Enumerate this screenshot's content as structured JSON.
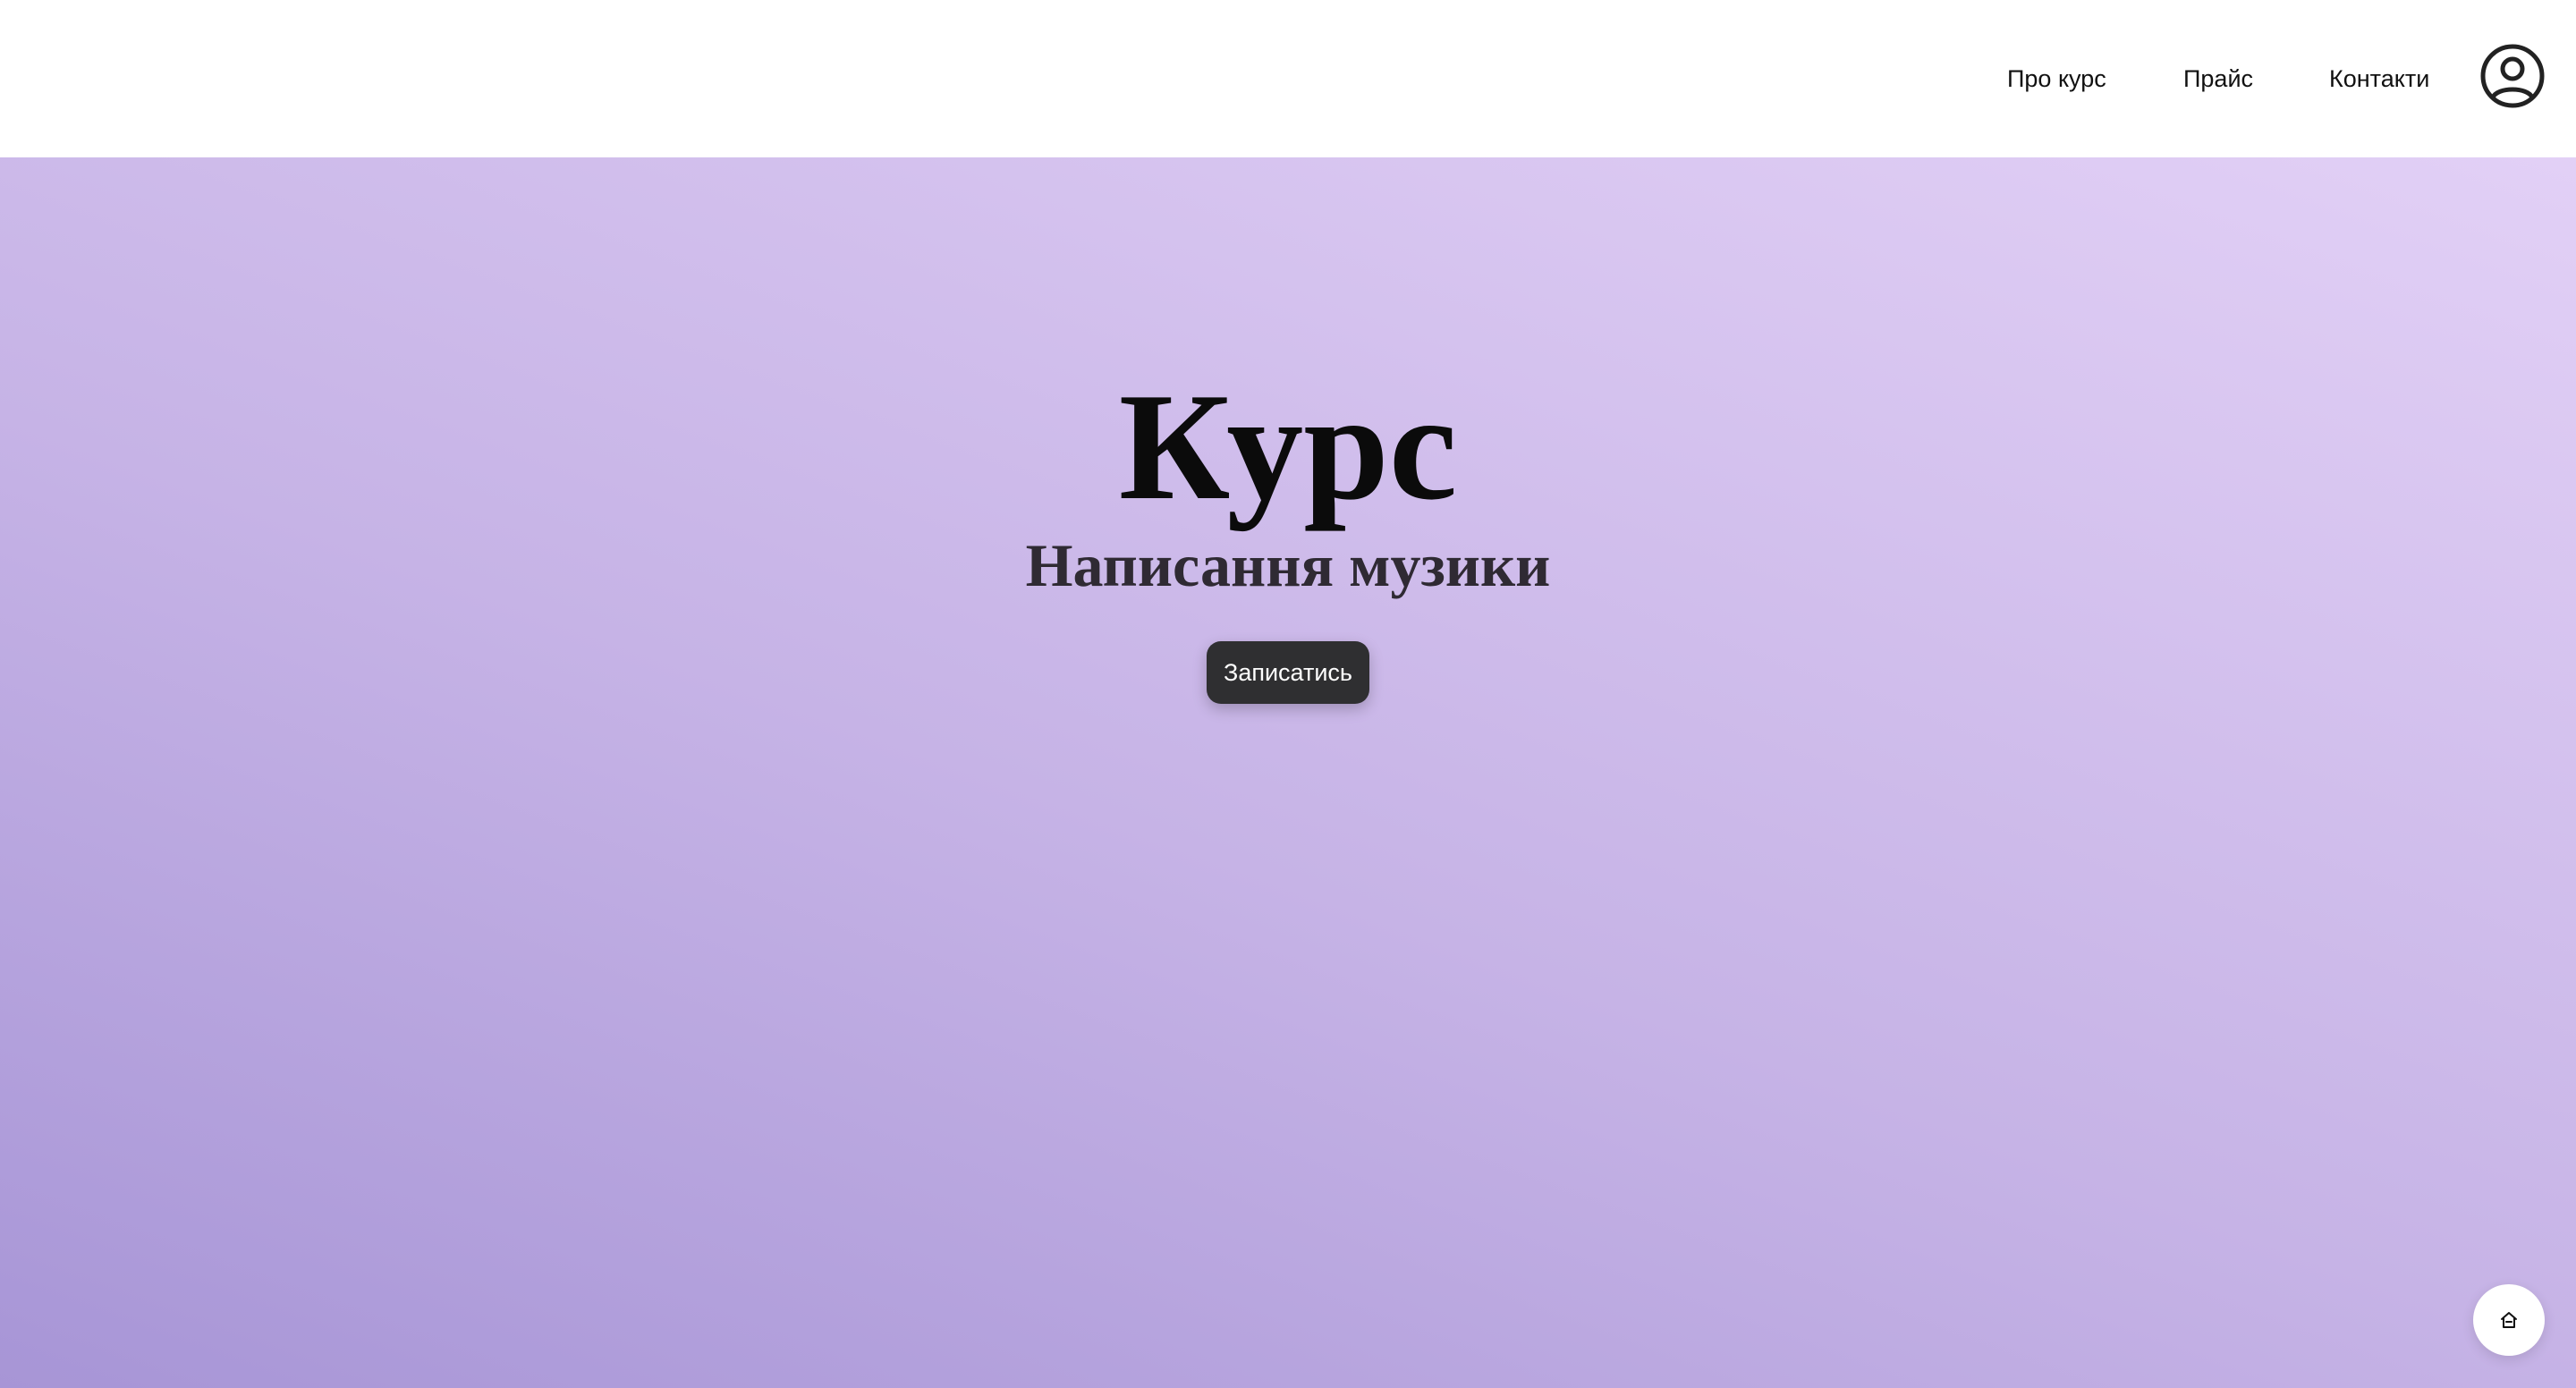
{
  "header": {
    "nav": [
      {
        "label": "Про курс"
      },
      {
        "label": "Прайс"
      },
      {
        "label": "Контакти"
      }
    ],
    "account_icon": "user-circle-icon"
  },
  "hero": {
    "title": "Курс",
    "subtitle": "Написання музики",
    "cta_label": "Записатись"
  },
  "floating": {
    "home_icon": "home-icon"
  },
  "colors": {
    "header_bg": "#ffffff",
    "gradient_start": "#a795d6",
    "gradient_mid": "#c6b3e6",
    "gradient_end": "#e2d0f6",
    "button_bg": "#2f2f31",
    "button_text": "#ffffff"
  }
}
